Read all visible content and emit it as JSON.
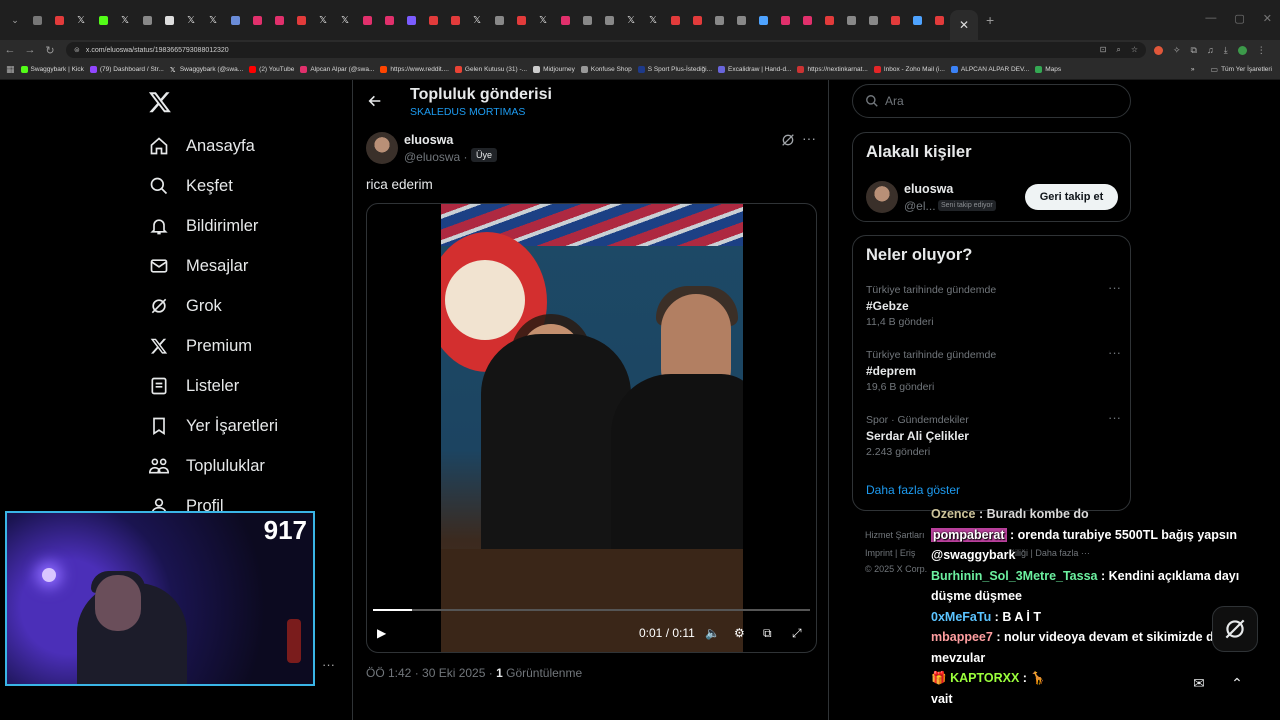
{
  "browser": {
    "url": "x.com/eluoswa/status/1983665793088012320",
    "bookmarks": [
      {
        "label": "Swaggybark | Kick",
        "color": "#53fc18"
      },
      {
        "label": "(79) Dashboard / Str...",
        "color": "#9146ff"
      },
      {
        "label": "Swaggybark (@swa...",
        "color": "#e7e9ea"
      },
      {
        "label": "(2) YouTube",
        "color": "#ff0000"
      },
      {
        "label": "Alpcan Alpar (@swa...",
        "color": "#e1306c"
      },
      {
        "label": "https://www.reddit....",
        "color": "#ff4500"
      },
      {
        "label": "Gelen Kutusu (31) -...",
        "color": "#ea4335"
      },
      {
        "label": "Midjourney",
        "color": "#cccccc"
      },
      {
        "label": "Konfuse Shop",
        "color": "#999999"
      },
      {
        "label": "S Sport Plus-İstediği...",
        "color": "#1e3a8a"
      },
      {
        "label": "Excalidraw | Hand-d...",
        "color": "#6965db"
      },
      {
        "label": "https://nextinkarnat...",
        "color": "#cc3333"
      },
      {
        "label": "Inbox - Zoho Mail (i...",
        "color": "#e42527"
      },
      {
        "label": "ALPCAN ALPAR DEV...",
        "color": "#3b82f6"
      },
      {
        "label": "Maps",
        "color": "#34a853"
      }
    ],
    "bookmarks_right": "Tüm Yer İşaretleri"
  },
  "nav": [
    {
      "label": "Anasayfa",
      "icon": "home-icon"
    },
    {
      "label": "Keşfet",
      "icon": "search-icon"
    },
    {
      "label": "Bildirimler",
      "icon": "bell-icon"
    },
    {
      "label": "Mesajlar",
      "icon": "mail-icon"
    },
    {
      "label": "Grok",
      "icon": "grok-icon"
    },
    {
      "label": "Premium",
      "icon": "x-icon"
    },
    {
      "label": "Listeler",
      "icon": "list-icon"
    },
    {
      "label": "Yer İşaretleri",
      "icon": "bookmark-icon"
    },
    {
      "label": "Topluluklar",
      "icon": "communities-icon"
    },
    {
      "label": "Profil",
      "icon": "profile-icon"
    }
  ],
  "header": {
    "title": "Topluluk gönderisi",
    "subtitle": "SKALEDUS MORTIMAS"
  },
  "post": {
    "name": "eluoswa",
    "handle": "@eluoswa ·",
    "badge": "Üye",
    "text": "rica ederim",
    "video_time": "0:01 / 0:11",
    "progress": 0.09,
    "meta_time": "ÖÖ 1:42 · 30 Eki 2025 ·",
    "views_count": "1",
    "views_label": "Görüntülenme"
  },
  "sidebar": {
    "search_placeholder": "Ara",
    "related_title": "Alakalı kişiler",
    "related": {
      "name": "eluoswa",
      "handle": "@el...",
      "badge": "Seni takip ediyor",
      "button": "Geri takip et"
    },
    "trends_title": "Neler oluyor?",
    "trends": [
      {
        "context": "Türkiye tarihinde gündemde",
        "name": "#Gebze",
        "count": "11,4 B gönderi"
      },
      {
        "context": "Türkiye tarihinde gündemde",
        "name": "#deprem",
        "count": "19,6 B gönderi"
      },
      {
        "context": "Spor · Gündemdekiler",
        "name": "Serdar Ali Çelikler",
        "count": "2.243 gönderi"
      }
    ],
    "show_more": "Daha fazla göster",
    "footer_1": "Hizmet Şartları",
    "footer_2": "Imprint   |   Eriş",
    "footer_2b": "ğiliği   |   Daha fazla ···",
    "footer_3": "© 2025 X Corp."
  },
  "stream": {
    "viewer_count": "917"
  },
  "chat": [
    {
      "user": "Ozence",
      "message": "Buradı kombe do",
      "color": "#f0e5b5"
    },
    {
      "user": "pompaberat",
      "message": "orenda turabiye 5500TL bağış yapsın @swaggybark",
      "color": "#ff7ad9",
      "highlight": true
    },
    {
      "user": "Burhinin_Sol_3Metre_Tassa",
      "message": "Kendini açıklama dayı düşme düşmee",
      "color": "#6cf0a0"
    },
    {
      "user": "0xMeFaTu",
      "message": "B A İ T",
      "color": "#5bc4ff"
    },
    {
      "user": "mbappee7",
      "message": "nolur videoya devam et sikimizde değil mevzular",
      "color": "#ff9ea0"
    },
    {
      "user": "KAPTORXX",
      "message": "",
      "color": "#9bff3c"
    },
    {
      "user": "",
      "message": "vait",
      "color": "#ffffff"
    }
  ]
}
